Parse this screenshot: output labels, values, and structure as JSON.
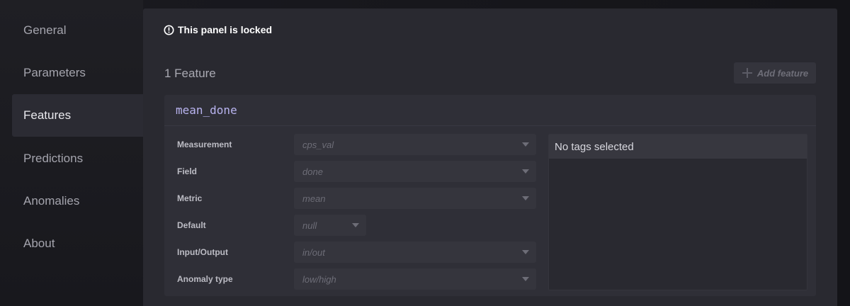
{
  "sidebar": {
    "items": [
      {
        "label": "General",
        "active": false
      },
      {
        "label": "Parameters",
        "active": false
      },
      {
        "label": "Features",
        "active": true
      },
      {
        "label": "Predictions",
        "active": false
      },
      {
        "label": "Anomalies",
        "active": false
      },
      {
        "label": "About",
        "active": false
      }
    ]
  },
  "panel": {
    "lock_message": "This panel is locked",
    "lock_icon": "exclamation-circle-icon",
    "feature_count": "1 Feature",
    "add_feature_label": "Add feature",
    "add_feature_icon": "plus-icon"
  },
  "feature": {
    "name": "mean_done",
    "fields": [
      {
        "label": "Measurement",
        "value": "cps_val"
      },
      {
        "label": "Field",
        "value": "done"
      },
      {
        "label": "Metric",
        "value": "mean"
      },
      {
        "label": "Default",
        "value": "null"
      },
      {
        "label": "Input/Output",
        "value": "in/out"
      },
      {
        "label": "Anomaly type",
        "value": "low/high"
      }
    ],
    "tags_placeholder": "No tags selected"
  },
  "colors": {
    "accent_name": "#b9b4f0",
    "panel_bg": "#292930",
    "card_bg": "#2f2f37"
  }
}
